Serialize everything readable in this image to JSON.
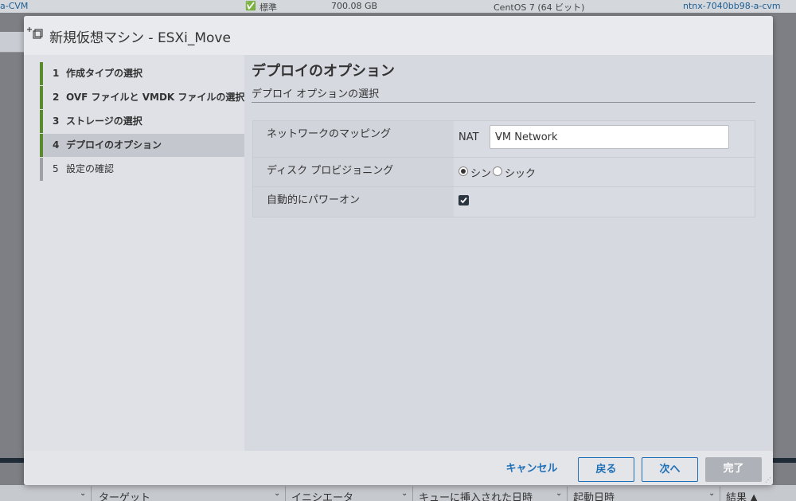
{
  "background": {
    "top_cells": [
      "a-CVM",
      "標準",
      "700.08 GB",
      "CentOS 7 (64 ビット)",
      "ntnx-7040bb98-a-cvm"
    ],
    "bottom_columns": [
      "ターゲット",
      "イニシエータ",
      "キューに挿入された日時",
      "起動日時",
      "結果 ▲"
    ]
  },
  "dialog": {
    "title": "新規仮想マシン - ESXi_Move",
    "steps": [
      {
        "num": "1",
        "label": "作成タイプの選択",
        "state": "done"
      },
      {
        "num": "2",
        "label": "OVF ファイルと VMDK ファイルの選択",
        "state": "done"
      },
      {
        "num": "3",
        "label": "ストレージの選択",
        "state": "done"
      },
      {
        "num": "4",
        "label": "デプロイのオプション",
        "state": "active"
      },
      {
        "num": "5",
        "label": "設定の確認",
        "state": "pending"
      }
    ],
    "main": {
      "title": "デプロイのオプション",
      "subtitle": "デプロイ オプションの選択",
      "network_label": "ネットワークのマッピング",
      "network_source": "NAT",
      "network_value": "VM Network",
      "disk_label": "ディスク プロビジョニング",
      "disk_options": [
        "シン",
        "シック"
      ],
      "disk_selected": "シン",
      "poweron_label": "自動的にパワーオン",
      "poweron_checked": true
    },
    "footer": {
      "cancel": "キャンセル",
      "back": "戻る",
      "next": "次へ",
      "finish": "完了"
    }
  },
  "colors": {
    "accent": "#1f6fb6",
    "step_done": "#5a8a2d",
    "disabled": "#aeb1b7"
  }
}
